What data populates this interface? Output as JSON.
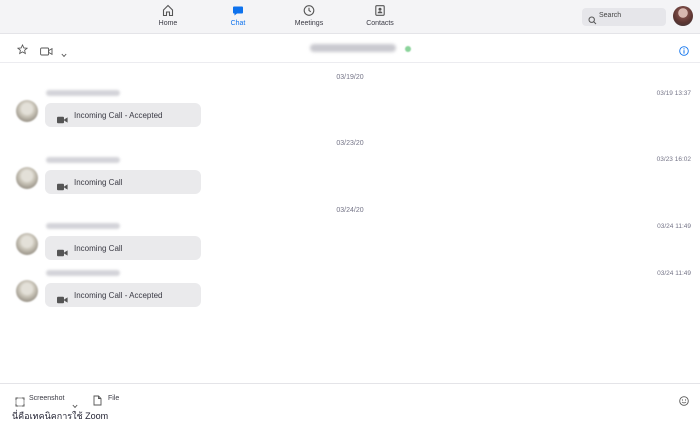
{
  "nav": {
    "tabs": [
      {
        "label": "Home",
        "icon": "home-icon"
      },
      {
        "label": "Chat",
        "icon": "chat-bubble-icon",
        "active": true
      },
      {
        "label": "Meetings",
        "icon": "clock-icon"
      },
      {
        "label": "Contacts",
        "icon": "contact-card-icon"
      }
    ],
    "search_label": "Search"
  },
  "chat_header": {
    "icons": [
      "star-icon",
      "video-icon",
      "chevron-down-icon",
      "info-icon"
    ]
  },
  "messages": [
    {
      "date": "03/19/20",
      "time": "03/19 13:37",
      "text": "Incoming Call - Accepted"
    },
    {
      "date": "03/23/20",
      "time": "03/23 16:02",
      "text": "Incoming Call"
    },
    {
      "date": "03/24/20",
      "time": "03/24 11:49",
      "text": "Incoming Call"
    },
    {
      "time": "03/24 11:49",
      "text": "Incoming Call - Accepted"
    }
  ],
  "composer": {
    "screenshot_label": "Screenshot",
    "file_label": "File",
    "input_text": "นี่คือเทคนิคการใช้ Zoom"
  },
  "colors": {
    "accent": "#0e72ed",
    "online": "#8ad39a",
    "bubble": "#eaeaec"
  }
}
